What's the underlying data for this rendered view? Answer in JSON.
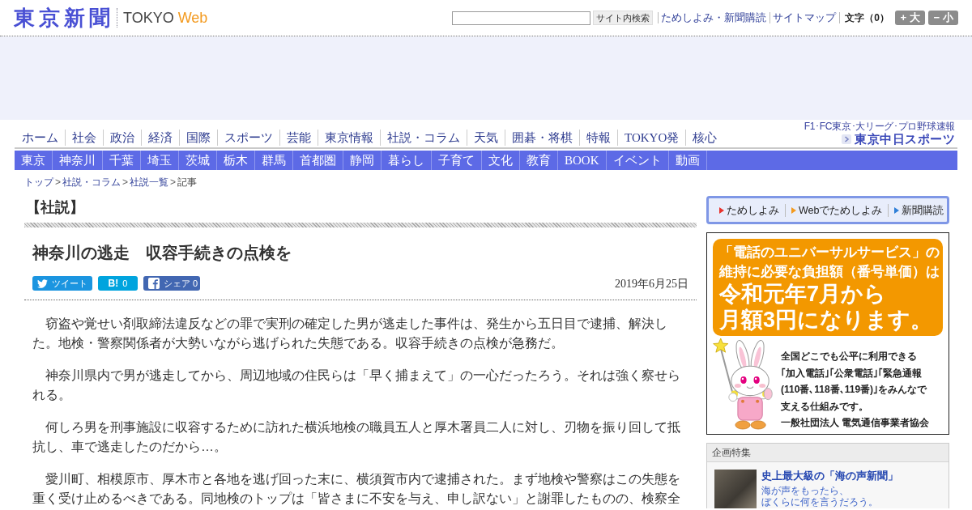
{
  "header": {
    "logo": {
      "name": "東京新聞",
      "brand": "TOKYO",
      "suffix": "Web"
    },
    "search": {
      "button": "サイト内検索"
    },
    "links": [
      "ためしよみ・新聞購読",
      "サイトマップ"
    ],
    "text_size": {
      "label": "文字（0）",
      "buttons": [
        "+ 大",
        "− 小"
      ]
    }
  },
  "nav_main": [
    "ホーム",
    "社会",
    "政治",
    "経済",
    "国際",
    "スポーツ",
    "芸能",
    "東京情報",
    "社説・コラム",
    "天気",
    "囲碁・将棋",
    "特報",
    "TOKYO発",
    "核心"
  ],
  "sports_link": {
    "caption": "F1･FC東京･大リーグ･プロ野球速報",
    "logo": "東京中日スポーツ"
  },
  "nav_regions": [
    "東京",
    "神奈川",
    "千葉",
    "埼玉",
    "茨城",
    "栃木",
    "群馬",
    "首都圏",
    "静岡",
    "暮らし",
    "子育て",
    "文化",
    "教育",
    "BOOK",
    "イベント",
    "動画"
  ],
  "breadcrumb": [
    {
      "label": "トップ",
      "kind": "link"
    },
    {
      "label": "社説・コラム",
      "kind": "link",
      "prefix": ">"
    },
    {
      "label": "社説一覧",
      "kind": "link",
      "prefix": ">"
    },
    {
      "label": "記事",
      "kind": "current",
      "prefix": ">"
    }
  ],
  "article": {
    "section": "【社説】",
    "title": "神奈川の逃走　収容手続きの点検を",
    "share": [
      {
        "kind": "twitter",
        "label": "ツイート"
      },
      {
        "kind": "hatena",
        "label": "B!",
        "count": "0"
      },
      {
        "kind": "facebook",
        "label": "シェア",
        "count": "0"
      }
    ],
    "date": "2019年6月25日",
    "paragraphs": [
      "窃盗や覚せい剤取締法違反などの罪で実刑の確定した男が逃走した事件は、発生から五日目で逮捕、解決した。地検・警察関係者が大勢いながら逃げられた失態である。収容手続きの点検が急務だ。",
      "神奈川県内で男が逃走してから、周辺地域の住民らは「早く捕まえて」の一心だったろう。それは強く察せられる。",
      "何しろ男を刑事施設に収容するために訪れた横浜地検の職員五人と厚木署員二人に対し、刃物を振り回して抵抗し、車で逃走したのだから…。",
      "愛川町、相模原市、厚木市と各地を逃げ回った末に、横須賀市内で逮捕された。まず地検や警察はこの失態を重く受け止めるべきである。同地検のトップは「皆さまに不安を与え、申し訳ない」と謝罪したものの、検察全"
    ]
  },
  "sidebar": {
    "quick_links": [
      {
        "label": "ためしよみ",
        "color": "#e8322c"
      },
      {
        "label": "Webでためしよみ",
        "color": "#f39a1f"
      },
      {
        "label": "新聞購読",
        "color": "#2f7fd8"
      }
    ],
    "ad": {
      "headline": [
        "「電話のユニバーサルサービス」の",
        "維持に必要な負担額（番号単価）は"
      ],
      "highlight": [
        "令和元年7月から",
        "月額3円になります。"
      ],
      "body": [
        "全国どこでも公平に利用できる",
        "｢加入電話｣｢公衆電話｣｢緊急通報",
        "(110番､118番､119番)｣をみんなで",
        "支える仕組みです。"
      ],
      "sponsor": "一般社団法人 電気通信事業者協会"
    },
    "features": {
      "title": "企画特集",
      "items": [
        {
          "title": "史上最大級の「海の声新聞」",
          "description": [
            "海が声をもったら、",
            "ぼくらに何を言うだろう。"
          ]
        }
      ]
    }
  }
}
